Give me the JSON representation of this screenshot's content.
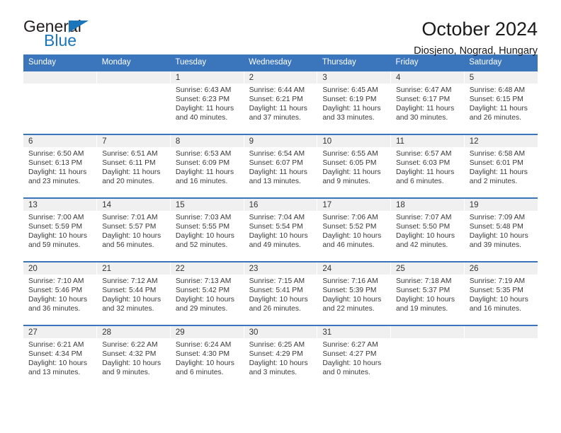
{
  "brand": {
    "name_part1": "General",
    "name_part2": "Blue",
    "triangle_icon": "triangle-icon",
    "accent_color": "#1b75bb"
  },
  "header": {
    "title": "October 2024",
    "location": "Diosjeno, Nograd, Hungary"
  },
  "theme": {
    "header_row_bg": "#3b76bc",
    "daynum_band_bg": "#f0f0f0",
    "text_color": "#3a3a3a"
  },
  "calendar": {
    "weekday_headers": [
      "Sunday",
      "Monday",
      "Tuesday",
      "Wednesday",
      "Thursday",
      "Friday",
      "Saturday"
    ],
    "weeks": [
      [
        {
          "day": "",
          "empty": true
        },
        {
          "day": "",
          "empty": true
        },
        {
          "day": "1",
          "sunrise": "Sunrise: 6:43 AM",
          "sunset": "Sunset: 6:23 PM",
          "daylight": "Daylight: 11 hours and 40 minutes."
        },
        {
          "day": "2",
          "sunrise": "Sunrise: 6:44 AM",
          "sunset": "Sunset: 6:21 PM",
          "daylight": "Daylight: 11 hours and 37 minutes."
        },
        {
          "day": "3",
          "sunrise": "Sunrise: 6:45 AM",
          "sunset": "Sunset: 6:19 PM",
          "daylight": "Daylight: 11 hours and 33 minutes."
        },
        {
          "day": "4",
          "sunrise": "Sunrise: 6:47 AM",
          "sunset": "Sunset: 6:17 PM",
          "daylight": "Daylight: 11 hours and 30 minutes."
        },
        {
          "day": "5",
          "sunrise": "Sunrise: 6:48 AM",
          "sunset": "Sunset: 6:15 PM",
          "daylight": "Daylight: 11 hours and 26 minutes."
        }
      ],
      [
        {
          "day": "6",
          "sunrise": "Sunrise: 6:50 AM",
          "sunset": "Sunset: 6:13 PM",
          "daylight": "Daylight: 11 hours and 23 minutes."
        },
        {
          "day": "7",
          "sunrise": "Sunrise: 6:51 AM",
          "sunset": "Sunset: 6:11 PM",
          "daylight": "Daylight: 11 hours and 20 minutes."
        },
        {
          "day": "8",
          "sunrise": "Sunrise: 6:53 AM",
          "sunset": "Sunset: 6:09 PM",
          "daylight": "Daylight: 11 hours and 16 minutes."
        },
        {
          "day": "9",
          "sunrise": "Sunrise: 6:54 AM",
          "sunset": "Sunset: 6:07 PM",
          "daylight": "Daylight: 11 hours and 13 minutes."
        },
        {
          "day": "10",
          "sunrise": "Sunrise: 6:55 AM",
          "sunset": "Sunset: 6:05 PM",
          "daylight": "Daylight: 11 hours and 9 minutes."
        },
        {
          "day": "11",
          "sunrise": "Sunrise: 6:57 AM",
          "sunset": "Sunset: 6:03 PM",
          "daylight": "Daylight: 11 hours and 6 minutes."
        },
        {
          "day": "12",
          "sunrise": "Sunrise: 6:58 AM",
          "sunset": "Sunset: 6:01 PM",
          "daylight": "Daylight: 11 hours and 2 minutes."
        }
      ],
      [
        {
          "day": "13",
          "sunrise": "Sunrise: 7:00 AM",
          "sunset": "Sunset: 5:59 PM",
          "daylight": "Daylight: 10 hours and 59 minutes."
        },
        {
          "day": "14",
          "sunrise": "Sunrise: 7:01 AM",
          "sunset": "Sunset: 5:57 PM",
          "daylight": "Daylight: 10 hours and 56 minutes."
        },
        {
          "day": "15",
          "sunrise": "Sunrise: 7:03 AM",
          "sunset": "Sunset: 5:55 PM",
          "daylight": "Daylight: 10 hours and 52 minutes."
        },
        {
          "day": "16",
          "sunrise": "Sunrise: 7:04 AM",
          "sunset": "Sunset: 5:54 PM",
          "daylight": "Daylight: 10 hours and 49 minutes."
        },
        {
          "day": "17",
          "sunrise": "Sunrise: 7:06 AM",
          "sunset": "Sunset: 5:52 PM",
          "daylight": "Daylight: 10 hours and 46 minutes."
        },
        {
          "day": "18",
          "sunrise": "Sunrise: 7:07 AM",
          "sunset": "Sunset: 5:50 PM",
          "daylight": "Daylight: 10 hours and 42 minutes."
        },
        {
          "day": "19",
          "sunrise": "Sunrise: 7:09 AM",
          "sunset": "Sunset: 5:48 PM",
          "daylight": "Daylight: 10 hours and 39 minutes."
        }
      ],
      [
        {
          "day": "20",
          "sunrise": "Sunrise: 7:10 AM",
          "sunset": "Sunset: 5:46 PM",
          "daylight": "Daylight: 10 hours and 36 minutes."
        },
        {
          "day": "21",
          "sunrise": "Sunrise: 7:12 AM",
          "sunset": "Sunset: 5:44 PM",
          "daylight": "Daylight: 10 hours and 32 minutes."
        },
        {
          "day": "22",
          "sunrise": "Sunrise: 7:13 AM",
          "sunset": "Sunset: 5:42 PM",
          "daylight": "Daylight: 10 hours and 29 minutes."
        },
        {
          "day": "23",
          "sunrise": "Sunrise: 7:15 AM",
          "sunset": "Sunset: 5:41 PM",
          "daylight": "Daylight: 10 hours and 26 minutes."
        },
        {
          "day": "24",
          "sunrise": "Sunrise: 7:16 AM",
          "sunset": "Sunset: 5:39 PM",
          "daylight": "Daylight: 10 hours and 22 minutes."
        },
        {
          "day": "25",
          "sunrise": "Sunrise: 7:18 AM",
          "sunset": "Sunset: 5:37 PM",
          "daylight": "Daylight: 10 hours and 19 minutes."
        },
        {
          "day": "26",
          "sunrise": "Sunrise: 7:19 AM",
          "sunset": "Sunset: 5:35 PM",
          "daylight": "Daylight: 10 hours and 16 minutes."
        }
      ],
      [
        {
          "day": "27",
          "sunrise": "Sunrise: 6:21 AM",
          "sunset": "Sunset: 4:34 PM",
          "daylight": "Daylight: 10 hours and 13 minutes."
        },
        {
          "day": "28",
          "sunrise": "Sunrise: 6:22 AM",
          "sunset": "Sunset: 4:32 PM",
          "daylight": "Daylight: 10 hours and 9 minutes."
        },
        {
          "day": "29",
          "sunrise": "Sunrise: 6:24 AM",
          "sunset": "Sunset: 4:30 PM",
          "daylight": "Daylight: 10 hours and 6 minutes."
        },
        {
          "day": "30",
          "sunrise": "Sunrise: 6:25 AM",
          "sunset": "Sunset: 4:29 PM",
          "daylight": "Daylight: 10 hours and 3 minutes."
        },
        {
          "day": "31",
          "sunrise": "Sunrise: 6:27 AM",
          "sunset": "Sunset: 4:27 PM",
          "daylight": "Daylight: 10 hours and 0 minutes."
        },
        {
          "day": "",
          "empty": true
        },
        {
          "day": "",
          "empty": true
        }
      ]
    ]
  }
}
